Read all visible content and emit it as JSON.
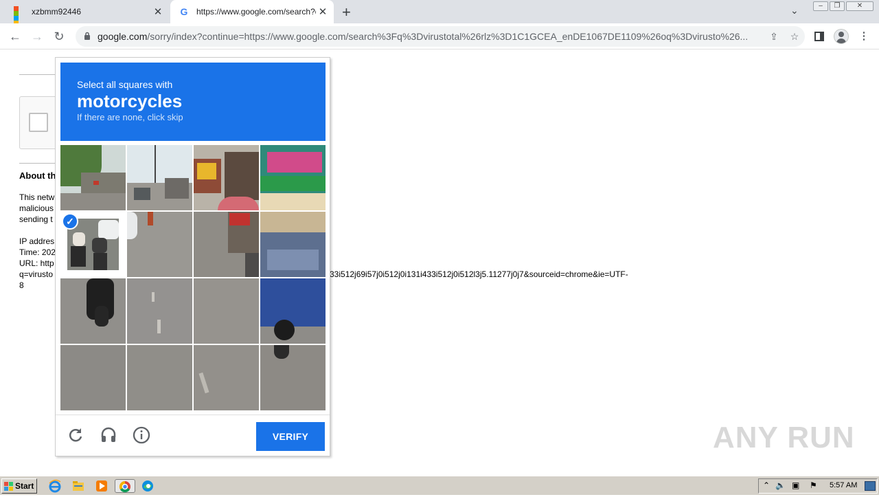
{
  "browser": {
    "tabs": [
      {
        "title": "xzbmm92446",
        "icon": "windows-logo-icon"
      },
      {
        "title": "https://www.google.com/search?q=",
        "icon": "google-g-icon"
      }
    ],
    "close_glyph": "✕",
    "new_tab_glyph": "+",
    "url_host": "google.com",
    "url_rest": "/sorry/index?continue=https://www.google.com/search%3Fq%3Dvirustotal%26rlz%3D1C1GCEA_enDE1067DE1109%26oq%3Dvirusto%26..."
  },
  "page": {
    "about_heading": "About th",
    "para1": [
      "This netw",
      "malicious",
      "sending t"
    ],
    "info": [
      "IP addres",
      "Time: 202",
      "URL: http",
      "q=virusto",
      "8"
    ],
    "url_tail": "33i512j69i57j0i512j0i131i433i512j0i512l3j5.11277j0j7&sourceid=chrome&ie=UTF-"
  },
  "challenge": {
    "line1": "Select all squares with",
    "object": "motorcycles",
    "line3": "If there are none, click skip",
    "selected_tiles": [
      4
    ],
    "verify_label": "VERIFY",
    "footer_icons": [
      "reload-icon",
      "audio-challenge-icon",
      "info-icon"
    ]
  },
  "watermark": "ANY RUN",
  "taskbar": {
    "start_label": "Start",
    "apps": [
      "ie-icon",
      "explorer-icon",
      "media-player-icon",
      "chrome-icon",
      "edge-icon"
    ],
    "clock": "5:57 AM"
  }
}
